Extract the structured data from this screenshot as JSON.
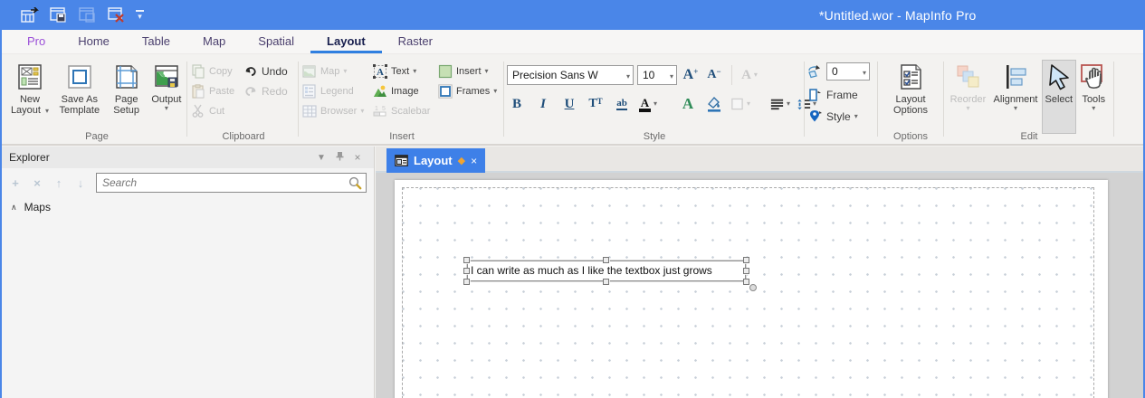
{
  "window": {
    "title": "*Untitled.wor - MapInfo Pro"
  },
  "icons": {
    "caret_down": "▾",
    "close": "×",
    "diamond": "◆",
    "collapse_up": "∧",
    "panel_chevron": "▼",
    "plus": "+",
    "remove": "×",
    "arrow_up": "↑",
    "arrow_down": "↓"
  },
  "tabs": {
    "items": [
      "Pro",
      "Home",
      "Table",
      "Map",
      "Spatial",
      "Layout",
      "Raster"
    ],
    "active_tab": "Layout"
  },
  "ribbon": {
    "page": {
      "label": "Page",
      "new_layout": "New Layout",
      "save_as_template": "Save As Template",
      "page_setup": "Page Setup",
      "output": "Output"
    },
    "clipboard": {
      "label": "Clipboard",
      "copy": "Copy",
      "paste": "Paste",
      "cut": "Cut",
      "undo": "Undo",
      "redo": "Redo"
    },
    "insert": {
      "label": "Insert",
      "map": "Map",
      "legend": "Legend",
      "browser": "Browser",
      "text": "Text",
      "image": "Image",
      "scalebar": "Scalebar",
      "insert_btn": "Insert",
      "frames": "Frames"
    },
    "style": {
      "label": "Style",
      "font_name": "Precision Sans W",
      "font_size": "10",
      "bold": "B",
      "italic": "I",
      "underline": "U"
    },
    "frame_tools": {
      "rotation_value": "0",
      "frame": "Frame",
      "style": "Style"
    },
    "options": {
      "label": "Options",
      "layout_options": "Layout Options"
    },
    "edit": {
      "label": "Edit",
      "reorder": "Reorder",
      "alignment": "Alignment",
      "select": "Select",
      "tools": "Tools"
    }
  },
  "explorer": {
    "title": "Explorer",
    "search_placeholder": "Search",
    "maps_section": "Maps"
  },
  "document": {
    "tab_label": "Layout",
    "textbox_text": "I can write as much as I like the textbox just grows"
  },
  "colors": {
    "titlebar": "#4a86e8",
    "doc_tab": "#3e80e8",
    "accent_navy": "#1f4e7a",
    "diamond": "#f0a431",
    "canvas_gray": "#d2d2d2",
    "active_tab_underline": "#2f7fe0",
    "pro_tab": "#9b4fd8"
  }
}
